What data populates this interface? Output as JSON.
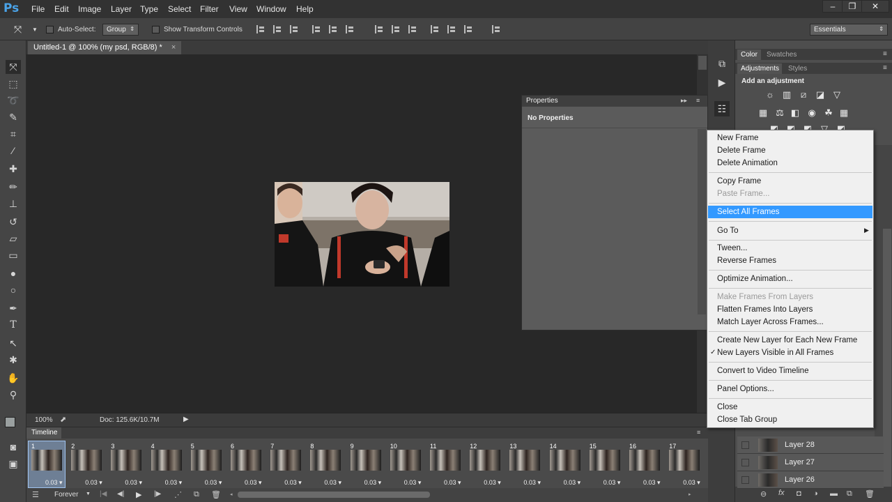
{
  "app": {
    "logo": "Ps",
    "menus": [
      "File",
      "Edit",
      "Image",
      "Layer",
      "Type",
      "Select",
      "Filter",
      "View",
      "Window",
      "Help"
    ],
    "window_controls": [
      "–",
      "❐",
      "✕"
    ]
  },
  "options_bar": {
    "auto_select_label": "Auto-Select:",
    "auto_select_value": "Group",
    "show_transform_label": "Show Transform Controls",
    "workspace": "Essentials"
  },
  "document": {
    "tab_title": "Untitled-1 @ 100% (my psd, RGB/8) *",
    "zoom": "100%",
    "doc_info": "Doc: 125.6K/10.7M"
  },
  "properties_panel": {
    "title": "Properties",
    "content": "No Properties"
  },
  "right_panel": {
    "tabs_top": [
      "Color",
      "Swatches"
    ],
    "tabs_adj": [
      "Adjustments",
      "Styles"
    ],
    "add_adjustment": "Add an adjustment",
    "layers": [
      {
        "name": "Layer 28"
      },
      {
        "name": "Layer 27"
      },
      {
        "name": "Layer 26"
      }
    ]
  },
  "timeline": {
    "title": "Timeline",
    "loop": "Forever",
    "frames": [
      {
        "num": "1",
        "delay": "0.03"
      },
      {
        "num": "2",
        "delay": "0.03"
      },
      {
        "num": "3",
        "delay": "0.03"
      },
      {
        "num": "4",
        "delay": "0.03"
      },
      {
        "num": "5",
        "delay": "0.03"
      },
      {
        "num": "6",
        "delay": "0.03"
      },
      {
        "num": "7",
        "delay": "0.03"
      },
      {
        "num": "8",
        "delay": "0.03"
      },
      {
        "num": "9",
        "delay": "0.03"
      },
      {
        "num": "10",
        "delay": "0.03"
      },
      {
        "num": "11",
        "delay": "0.03"
      },
      {
        "num": "12",
        "delay": "0.03"
      },
      {
        "num": "13",
        "delay": "0.03"
      },
      {
        "num": "14",
        "delay": "0.03"
      },
      {
        "num": "15",
        "delay": "0.03"
      },
      {
        "num": "16",
        "delay": "0.03"
      },
      {
        "num": "17",
        "delay": "0.03"
      }
    ]
  },
  "context_menu": {
    "new_frame": "New Frame",
    "delete_frame": "Delete Frame",
    "delete_animation": "Delete Animation",
    "copy_frame": "Copy Frame",
    "paste_frame": "Paste Frame...",
    "select_all_frames": "Select All Frames",
    "go_to": "Go To",
    "tween": "Tween...",
    "reverse_frames": "Reverse Frames",
    "optimize_animation": "Optimize Animation...",
    "make_frames_from_layers": "Make Frames From Layers",
    "flatten_frames": "Flatten Frames Into Layers",
    "match_layer": "Match Layer Across Frames...",
    "create_new_layer": "Create New Layer for Each New Frame",
    "new_layers_visible": "New Layers Visible in All Frames",
    "convert_video": "Convert to Video Timeline",
    "panel_options": "Panel Options...",
    "close": "Close",
    "close_tab_group": "Close Tab Group"
  }
}
